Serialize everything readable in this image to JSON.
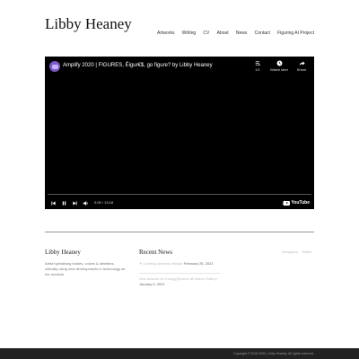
{
  "site": {
    "title": "Libby Heaney"
  },
  "nav": [
    "Artworks",
    "Writing",
    "CV",
    "About",
    "News",
    "Contact",
    "Figuring AI Project"
  ],
  "video": {
    "title": "Amplify 2020 | FIGURES, Éigur€$, go figure? by Libby Heaney",
    "playlist_count": "1/1",
    "watch_later": "Watch later",
    "share": "Share",
    "time": "0:00 / 13:18",
    "progress": 0,
    "logo_text": "YouTube"
  },
  "footer": {
    "name": "Libby Heaney",
    "description": "Artist hybridising bodies, voices & identities, critically using new developments in technology as her medium.",
    "recent_news_heading": "Recent News",
    "news": [
      {
        "title": "✦ Creating animals release",
        "date": "February 25, 2021"
      },
      {
        "title": "New artwork for Exergy@home at Hutton Gallery",
        "date": "January 6, 2021"
      }
    ],
    "social": [
      "Instagram",
      "Twitter"
    ]
  },
  "copyright": "Copyright © 2015-2020, Libby Heaney. All rights reserved."
}
